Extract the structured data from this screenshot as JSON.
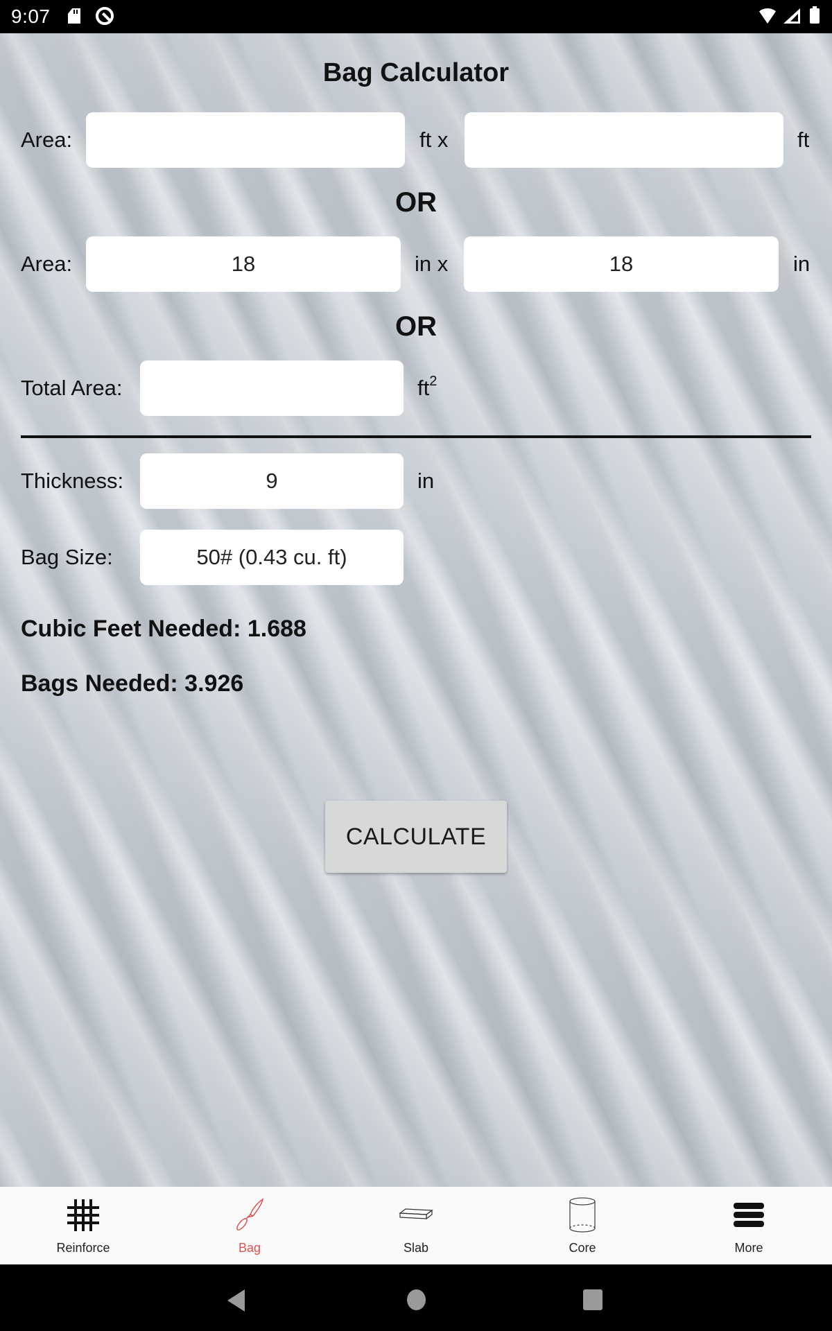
{
  "status_bar": {
    "time": "9:07",
    "left_icons": [
      "sd-card-icon",
      "data-saver-icon"
    ],
    "right_icons": [
      "wifi-icon",
      "cell-signal-icon",
      "battery-icon"
    ]
  },
  "page": {
    "title": "Bag Calculator",
    "or_separator": "OR",
    "area_ft": {
      "label": "Area:",
      "length_value": "",
      "length_unit": "ft x",
      "width_value": "",
      "width_unit": "ft"
    },
    "area_in": {
      "label": "Area:",
      "length_value": "18",
      "length_unit": "in x",
      "width_value": "18",
      "width_unit": "in"
    },
    "total_area": {
      "label": "Total Area:",
      "value": "",
      "unit": "ft",
      "unit_exponent": "2"
    },
    "thickness": {
      "label": "Thickness:",
      "value": "9",
      "unit": "in"
    },
    "bag_size": {
      "label": "Bag Size:",
      "selected": "50# (0.43 cu. ft)"
    },
    "results": {
      "cubic_feet": "Cubic Feet Needed: 1.688",
      "bags": "Bags Needed: 3.926"
    },
    "calculate_label": "CALCULATE"
  },
  "tabs": [
    {
      "label": "Reinforce",
      "icon": "grid-icon",
      "active": false
    },
    {
      "label": "Bag",
      "icon": "trowel-icon",
      "active": true
    },
    {
      "label": "Slab",
      "icon": "slab-icon",
      "active": false
    },
    {
      "label": "Core",
      "icon": "cylinder-icon",
      "active": false
    },
    {
      "label": "More",
      "icon": "menu-icon",
      "active": false
    }
  ],
  "colors": {
    "active_tab": "#d9534f",
    "button_bg": "#d7d9d9",
    "tabbar_bg": "#fafafa"
  }
}
